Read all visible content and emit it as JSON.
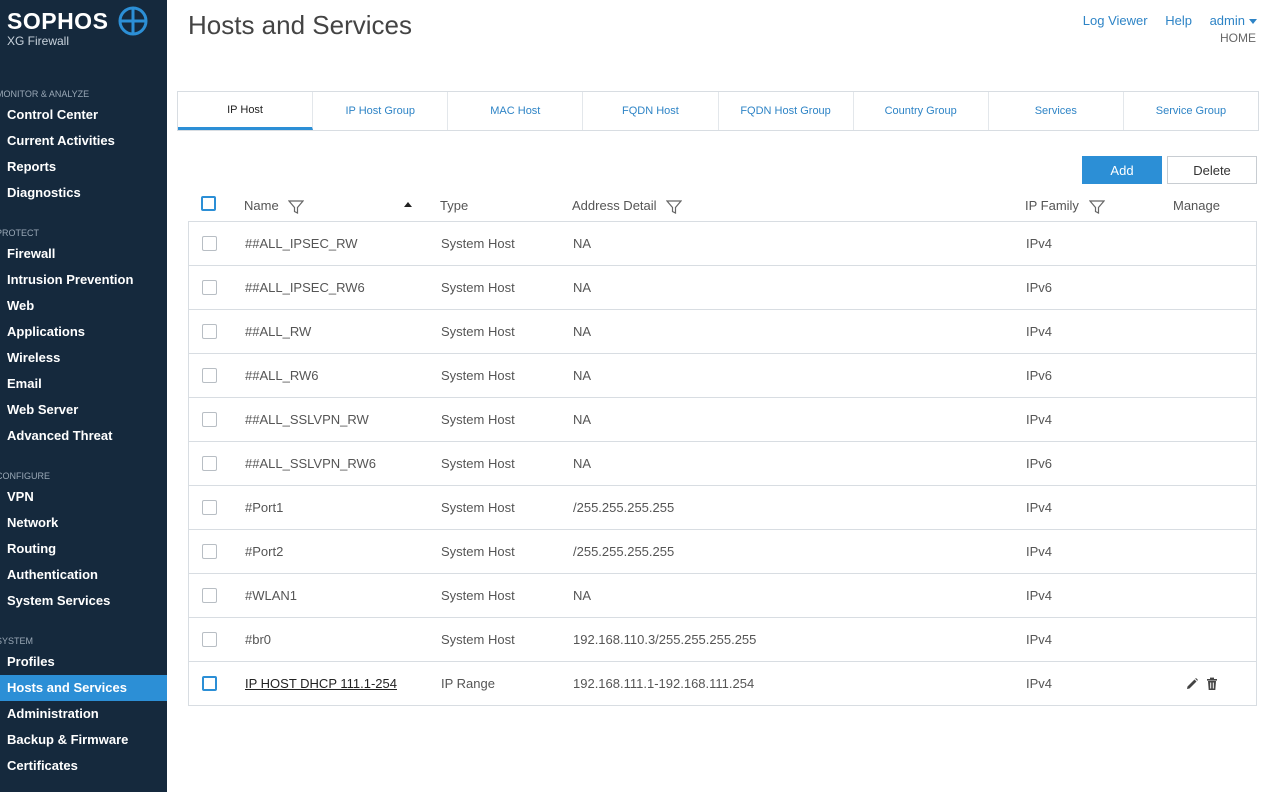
{
  "brand": {
    "name": "SOPHOS",
    "product": "XG Firewall"
  },
  "sidebar": {
    "sections": [
      {
        "head": "MONITOR & ANALYZE",
        "items": [
          {
            "label": "Control Center"
          },
          {
            "label": "Current Activities"
          },
          {
            "label": "Reports"
          },
          {
            "label": "Diagnostics"
          }
        ]
      },
      {
        "head": "PROTECT",
        "items": [
          {
            "label": "Firewall"
          },
          {
            "label": "Intrusion Prevention"
          },
          {
            "label": "Web"
          },
          {
            "label": "Applications"
          },
          {
            "label": "Wireless"
          },
          {
            "label": "Email"
          },
          {
            "label": "Web Server"
          },
          {
            "label": "Advanced Threat"
          }
        ]
      },
      {
        "head": "CONFIGURE",
        "items": [
          {
            "label": "VPN"
          },
          {
            "label": "Network"
          },
          {
            "label": "Routing"
          },
          {
            "label": "Authentication"
          },
          {
            "label": "System Services"
          }
        ]
      },
      {
        "head": "SYSTEM",
        "items": [
          {
            "label": "Profiles"
          },
          {
            "label": "Hosts and Services",
            "active": true
          },
          {
            "label": "Administration"
          },
          {
            "label": "Backup & Firmware"
          },
          {
            "label": "Certificates"
          }
        ]
      }
    ]
  },
  "header": {
    "title": "Hosts and Services",
    "log_viewer": "Log Viewer",
    "help": "Help",
    "user": "admin",
    "crumb": "HOME"
  },
  "tabs": [
    {
      "label": "IP Host",
      "active": true
    },
    {
      "label": "IP Host Group"
    },
    {
      "label": "MAC Host"
    },
    {
      "label": "FQDN Host"
    },
    {
      "label": "FQDN Host Group"
    },
    {
      "label": "Country Group"
    },
    {
      "label": "Services"
    },
    {
      "label": "Service Group"
    }
  ],
  "toolbar": {
    "add_label": "Add",
    "delete_label": "Delete"
  },
  "table": {
    "columns": {
      "name": "Name",
      "type": "Type",
      "address": "Address Detail",
      "family": "IP Family",
      "manage": "Manage"
    },
    "rows": [
      {
        "name": "##ALL_IPSEC_RW",
        "type": "System Host",
        "address": "NA",
        "family": "IPv4"
      },
      {
        "name": "##ALL_IPSEC_RW6",
        "type": "System Host",
        "address": "NA",
        "family": "IPv6"
      },
      {
        "name": "##ALL_RW",
        "type": "System Host",
        "address": "NA",
        "family": "IPv4"
      },
      {
        "name": "##ALL_RW6",
        "type": "System Host",
        "address": "NA",
        "family": "IPv6"
      },
      {
        "name": "##ALL_SSLVPN_RW",
        "type": "System Host",
        "address": "NA",
        "family": "IPv4"
      },
      {
        "name": "##ALL_SSLVPN_RW6",
        "type": "System Host",
        "address": "NA",
        "family": "IPv6"
      },
      {
        "name": "#Port1",
        "type": "System Host",
        "address": "/255.255.255.255",
        "family": "IPv4"
      },
      {
        "name": "#Port2",
        "type": "System Host",
        "address": "/255.255.255.255",
        "family": "IPv4"
      },
      {
        "name": "#WLAN1",
        "type": "System Host",
        "address": "NA",
        "family": "IPv4"
      },
      {
        "name": "#br0",
        "type": "System Host",
        "address": "192.168.110.3/255.255.255.255",
        "family": "IPv4"
      },
      {
        "name": "IP HOST DHCP 111.1-254",
        "type": "IP Range",
        "address": "192.168.111.1-192.168.111.254",
        "family": "IPv4",
        "editable": true
      }
    ]
  },
  "colors": {
    "sidebar_bg": "#15293d",
    "accent": "#2c8fd6",
    "link": "#2e84c6"
  }
}
